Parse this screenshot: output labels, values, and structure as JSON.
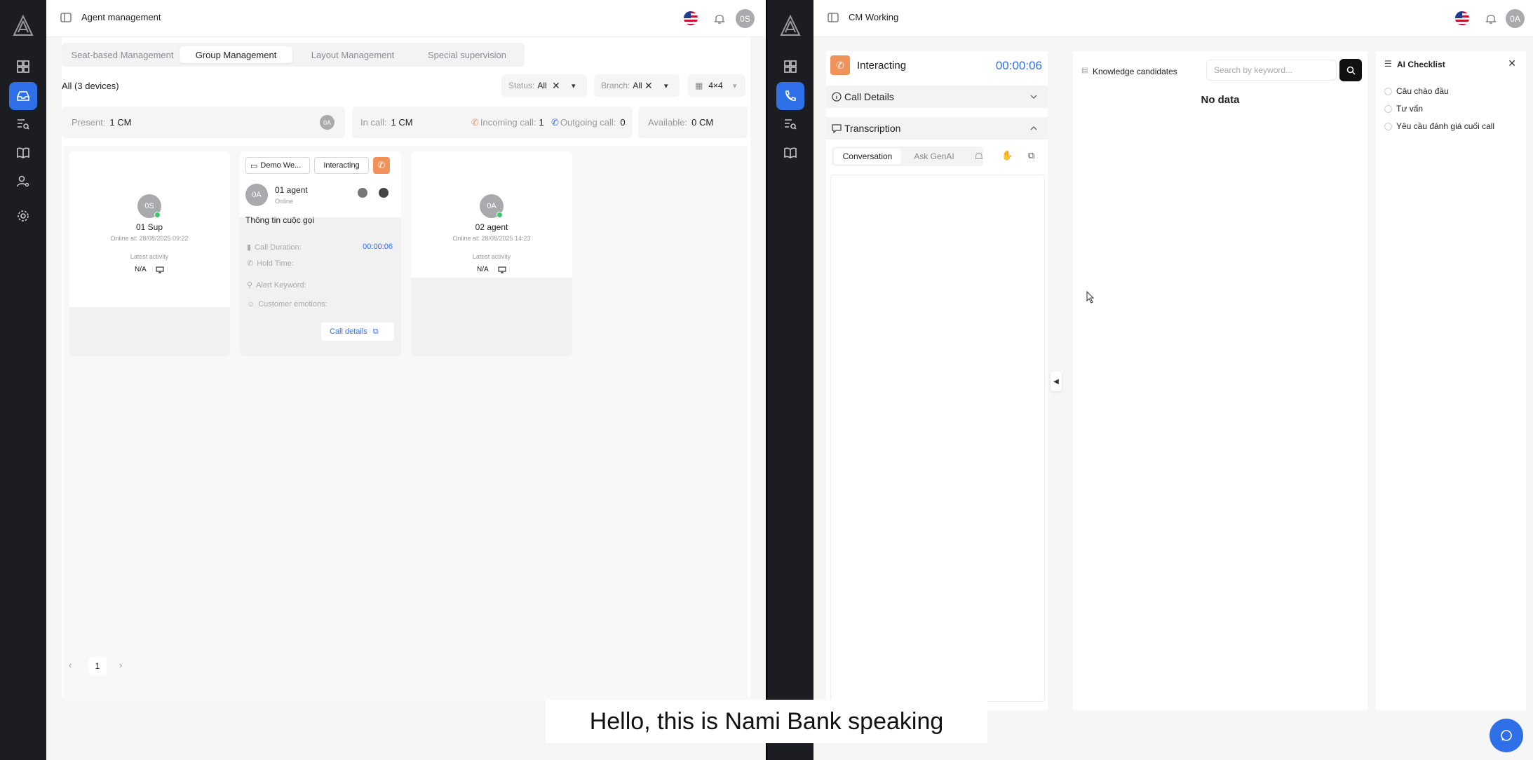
{
  "left": {
    "title": "Agent management",
    "user_initials": "0S",
    "tabs": [
      "Seat-based Management",
      "Group Management",
      "Layout Management",
      "Special supervision"
    ],
    "active_tab": "Group Management",
    "all_devices": "All (3 devices)",
    "filters": {
      "status_label": "Status:",
      "status_value": "All",
      "branch_label": "Branch:",
      "branch_value": "All",
      "grid_value": "4×4"
    },
    "stats": {
      "present_label": "Present:",
      "present_value": "1 CM",
      "present_avatar": "0A",
      "incall_label": "In call:",
      "incall_value": "1 CM",
      "incoming_label": "Incoming call:",
      "incoming_value": "1",
      "outgoing_label": "Outgoing call:",
      "outgoing_value": "0",
      "available_label": "Available:",
      "available_value": "0 CM"
    },
    "cards": [
      {
        "initials": "0S",
        "name": "01 Sup",
        "online_at": "Online at: 28/08/2025 09:22",
        "activity_label": "Latest activity",
        "activity_value": "N/A"
      },
      {
        "device": "Demo We...",
        "state": "Interacting",
        "initials": "0A",
        "name": "01 agent",
        "status": "Online",
        "info_title": "Thông tin cuộc gọi",
        "duration_label": "Call Duration:",
        "duration_value": "00:00:06",
        "hold_label": "Hold Time:",
        "keyword_label": "Alert Keyword:",
        "emotions_label": "Customer emotions:",
        "details_link": "Call details"
      },
      {
        "initials": "0A",
        "name": "02 agent",
        "online_at": "Online at: 28/08/2025 14:23",
        "activity_label": "Latest activity",
        "activity_value": "N/A"
      }
    ],
    "pager": {
      "prev": "‹",
      "page": "1",
      "next": "›"
    }
  },
  "right": {
    "title": "CM Working",
    "user_initials": "0A",
    "status": "Interacting",
    "timer": "00:00:06",
    "call_details": "Call Details",
    "transcription": "Transcription",
    "sub_tabs": [
      "Conversation",
      "Ask GenAI"
    ],
    "knowledge_title": "Knowledge candidates",
    "search_placeholder": "Search by keyword...",
    "no_data": "No data",
    "checklist_title": "AI Checklist",
    "checklist": [
      "Câu chào đầu",
      "Tư vấn",
      "Yêu cầu đánh giá cuối call"
    ]
  },
  "caption": "Hello, this is Nami Bank speaking",
  "colors": {
    "accent": "#2f6fe8",
    "orange": "#f0925a",
    "rail": "#1c1d22",
    "online": "#3ac86a"
  }
}
